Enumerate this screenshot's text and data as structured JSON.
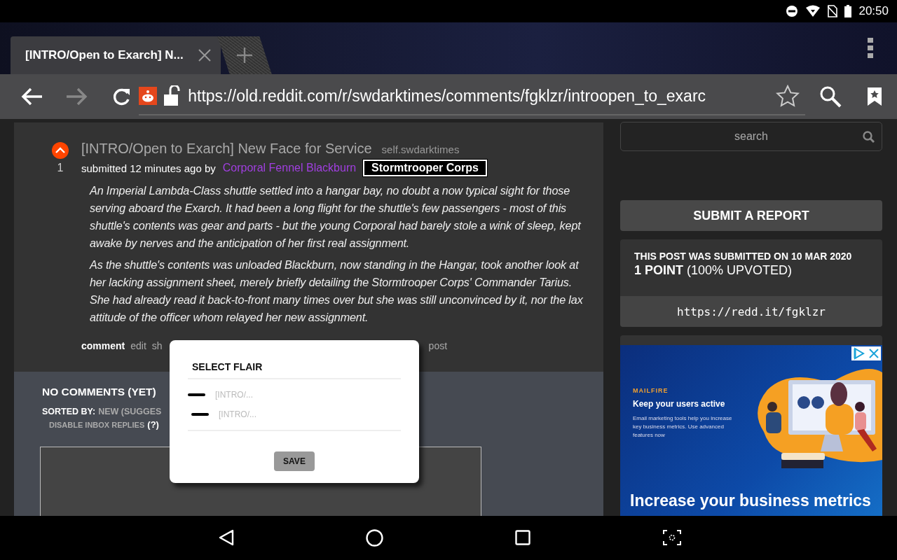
{
  "status_bar": {
    "time": "20:50"
  },
  "browser": {
    "tabs": [
      {
        "title": "[INTRO/Open to Exarch] N...",
        "selected": true
      }
    ],
    "url": "https://old.reddit.com/r/swdarktimes/comments/fgklzr/introopen_to_exarc"
  },
  "post": {
    "score": "1",
    "upvoted": true,
    "title": "[INTRO/Open to Exarch] New Face for Service",
    "domain": "self.swdarktimes",
    "submitted": "submitted 12 minutes ago by",
    "author": "Corporal Fennel Blackburn",
    "flair": "Stormtrooper Corps",
    "paragraphs": [
      "An Imperial Lambda-Class shuttle settled into a hangar bay, no doubt a now typical sight for those serving aboard the Exarch. It had been a long flight for the shuttle's few passengers - most of this shuttle's contents was gear and parts - but the young Corporal had barely stole a wink of sleep, kept awake by nerves and the anticipation of her first real assignment.",
      "As the shuttle's contents was unloaded Blackburn, now standing in the Hangar, took another look at her lacking assignment sheet, merely briefly detailing the Stormtrooper Corps' Commander Tarius. She had already read it back-to-front many times over but she was still unconvinced by it, nor the lax attitude of the officer whom relayed her new assignment."
    ],
    "actions": [
      "comment",
      "edit",
      "sh",
      "post"
    ]
  },
  "comments": {
    "heading": "NO COMMENTS (YET)",
    "sorted_label": "SORTED BY:",
    "sorted_value": "NEW (SUGGES",
    "disable_replies": "DISABLE INBOX REPLIES",
    "help": "(?)"
  },
  "sidebar": {
    "search": {
      "placeholder": "search"
    },
    "report_button": "SUBMIT A REPORT",
    "info": {
      "submitted": "THIS POST WAS SUBMITTED ON 10 MAR 2020",
      "points": "1 POINT",
      "upvoted": "(100% UPVOTED)",
      "shortlink": "https://redd.it/fgklzr"
    },
    "ad": {
      "brand": "MAILFIRE",
      "headline": "Keep your users active",
      "body": "Email marketing tools help you increase key business metrics. Use advanced features now",
      "banner": "Increase your business metrics"
    }
  },
  "modal": {
    "title": "SELECT FLAIR",
    "options": [
      {
        "label": "[INTRO/..."
      },
      {
        "label": "[INTRO/..."
      }
    ],
    "save": "SAVE"
  }
}
